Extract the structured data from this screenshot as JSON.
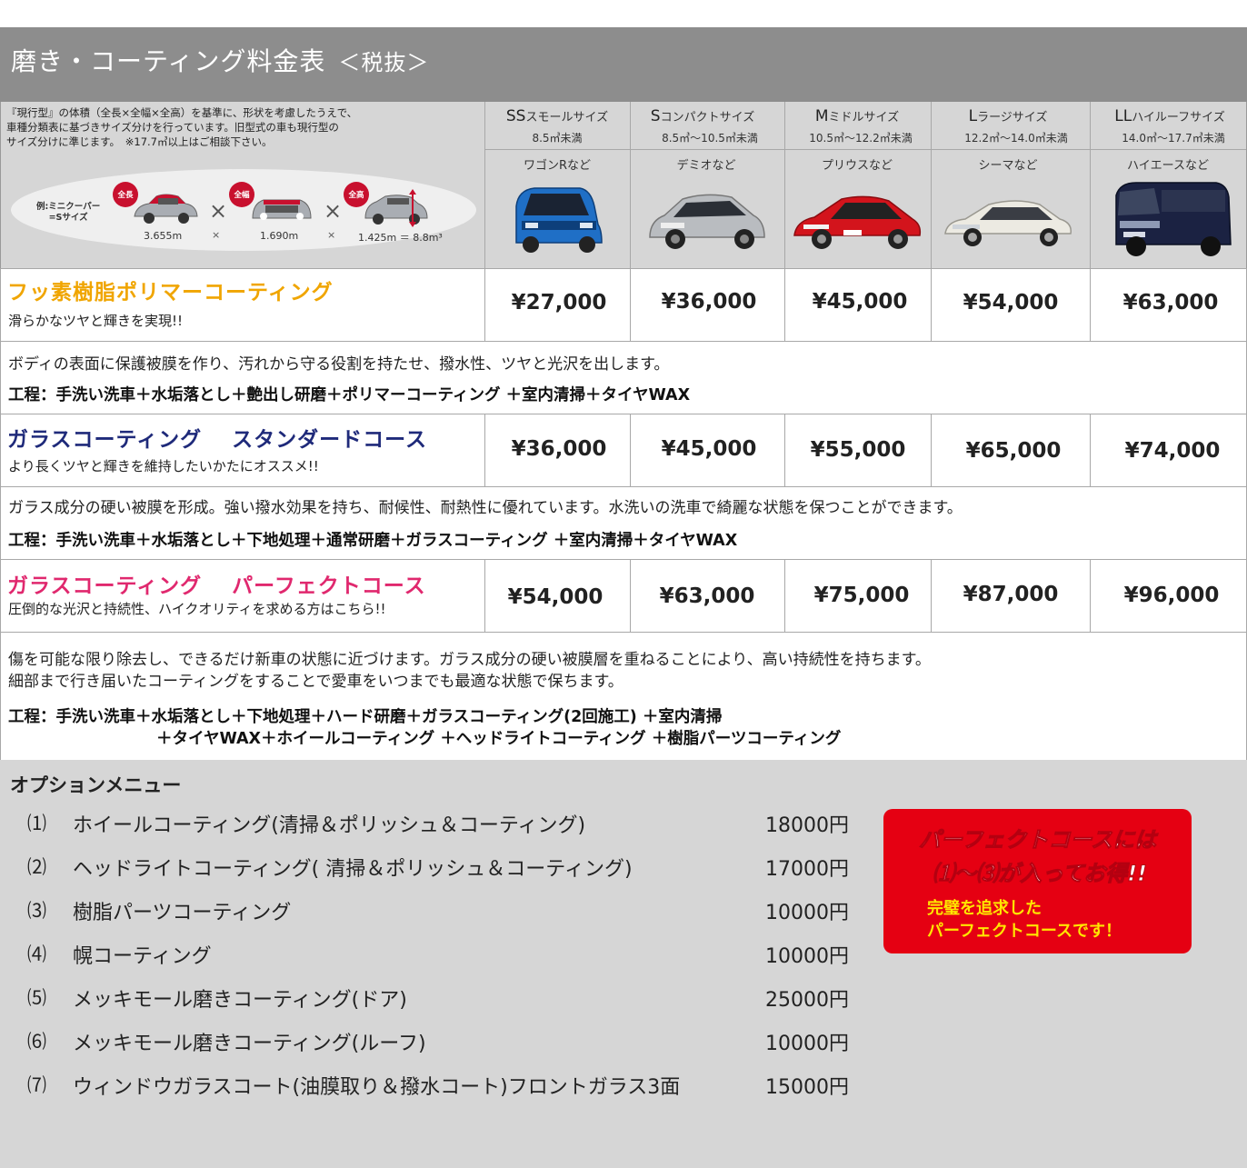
{
  "page": {
    "title": "磨き・コーティング料金表",
    "tax_note": "＜税抜＞"
  },
  "header": {
    "note_lines": [
      "『現行型』の体積（全長×全幅×全高）を基準に、形状を考慮したうえで、",
      "車種分類表に基づきサイズ分けを行っています。旧型式の車も現行型の",
      "サイズ分けに準じます。　※17.7㎥以上はご相談下さい。"
    ],
    "example": {
      "label_line1": "例:ミニクーパー",
      "label_line2": "=Sサイズ",
      "badges": [
        "全長",
        "全幅",
        "全高"
      ],
      "length": "3.655m",
      "width": "1.690m",
      "height": "1.425m",
      "equals": "＝",
      "volume": "8.8m³",
      "times": "×"
    }
  },
  "sizes": [
    {
      "code": "SS",
      "name": "スモールサイズ",
      "range": "8.5㎥未満",
      "example": "ワゴンRなど",
      "car_color": "#1f6fc6"
    },
    {
      "code": "S",
      "name": "コンパクトサイズ",
      "range": "8.5㎥〜10.5㎥未満",
      "example": "デミオなど",
      "car_color": "#b9bcc0"
    },
    {
      "code": "M",
      "name": "ミドルサイズ",
      "range": "10.5㎥〜12.2㎥未満",
      "example": "プリウスなど",
      "car_color": "#d3141c"
    },
    {
      "code": "L",
      "name": "ラージサイズ",
      "range": "12.2㎥〜14.0㎥未満",
      "example": "シーマなど",
      "car_color": "#eceae2"
    },
    {
      "code": "LL",
      "name": "ハイルーフサイズ",
      "range": "14.0㎥〜17.7㎥未満",
      "example": "ハイエースなど",
      "car_color": "#1b2242"
    }
  ],
  "courses": [
    {
      "title": "フッ素樹脂ポリマーコーティング",
      "title_color": "#f0a500",
      "subtitle": "滑らかなツヤと輝きを実現!!",
      "prices": [
        "¥27,000",
        "¥36,000",
        "¥45,000",
        "¥54,000",
        "¥63,000"
      ],
      "description": [
        "ボディの表面に保護被膜を作り、汚れから守る役割を持たせ、撥水性、ツヤと光沢を出します。"
      ],
      "process": [
        "工程：手洗い洗車＋水垢落とし＋艶出し研磨＋ポリマーコーティング ＋室内清掃＋タイヤWAX"
      ]
    },
    {
      "title": "ガラスコーティング　 スタンダードコース",
      "title_color": "#1f2a7a",
      "subtitle": "より長くツヤと輝きを維持したいかたにオススメ!!",
      "prices": [
        "¥36,000",
        "¥45,000",
        "¥55,000",
        "¥65,000",
        "¥74,000"
      ],
      "description": [
        "ガラス成分の硬い被膜を形成。強い撥水効果を持ち、耐候性、耐熱性に優れています。水洗いの洗車で綺麗な状態を保つことができます。"
      ],
      "process": [
        "工程：手洗い洗車＋水垢落とし＋下地処理＋通常研磨＋ガラスコーティング ＋室内清掃＋タイヤWAX"
      ]
    },
    {
      "title": "ガラスコーティング　 パーフェクトコース",
      "title_color": "#e0286e",
      "subtitle": "圧倒的な光沢と持続性、ハイクオリティを求める方はこちら!!",
      "prices": [
        "¥54,000",
        "¥63,000",
        "¥75,000",
        "¥87,000",
        "¥96,000"
      ],
      "description": [
        "傷を可能な限り除去し、できるだけ新車の状態に近づけます。ガラス成分の硬い被膜層を重ねることにより、高い持続性を持ちます。",
        "細部まで行き届いたコーティングをすることで愛車をいつまでも最適な状態で保ちます。"
      ],
      "process": [
        "工程：手洗い洗車＋水垢落とし＋下地処理＋ハード研磨＋ガラスコーティング(2回施工) ＋室内清掃",
        "＋タイヤWAX＋ホイールコーティング ＋ヘッドライトコーティング ＋樹脂パーツコーティング"
      ]
    }
  ],
  "options": {
    "title": "オプションメニュー",
    "items": [
      {
        "num": "⑴",
        "label": "ホイールコーティング(清掃＆ポリッシュ＆コーティング)",
        "price": "18000円"
      },
      {
        "num": "⑵",
        "label": "ヘッドライトコーティング( 清掃＆ポリッシュ＆コーティング)",
        "price": "17000円"
      },
      {
        "num": "⑶",
        "label": "樹脂パーツコーティング",
        "price": "10000円"
      },
      {
        "num": "⑷",
        "label": "幌コーティング",
        "price": "10000円"
      },
      {
        "num": "⑸",
        "label": "メッキモール磨きコーティング(ドア)",
        "price": "25000円"
      },
      {
        "num": "⑹",
        "label": "メッキモール磨きコーティング(ルーフ)",
        "price": "10000円"
      },
      {
        "num": "⑺",
        "label": "ウィンドウガラスコート(油膜取り＆撥水コート)フロントガラス3面",
        "price": "15000円"
      }
    ]
  },
  "promo": {
    "line1": "パーフェクトコースには",
    "line2": "⑴〜⑶が入ってお得!!",
    "line3": "完璧を追求した",
    "line4": "パーフェクトコースです！",
    "bg_color": "#e50012",
    "accent_color": "#ffe600"
  }
}
